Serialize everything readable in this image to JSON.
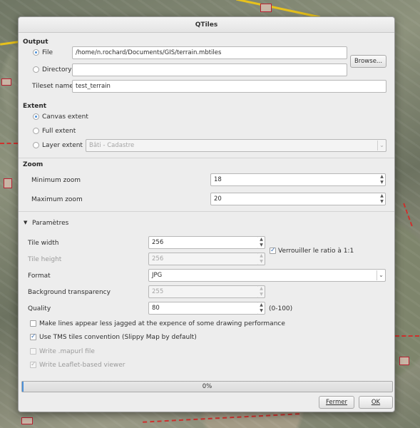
{
  "window": {
    "title": "QTiles"
  },
  "output": {
    "section": "Output",
    "file_label": "File",
    "file_value": "/home/n.rochard/Documents/GIS/terrain.mbtiles",
    "browse_label": "Browse...",
    "directory_label": "Directory",
    "directory_value": "",
    "tileset_label": "Tileset name",
    "tileset_value": "test_terrain"
  },
  "extent": {
    "section": "Extent",
    "canvas_label": "Canvas extent",
    "full_label": "Full extent",
    "layer_label": "Layer extent",
    "layer_value": "Bâti - Cadastre"
  },
  "zoom": {
    "section": "Zoom",
    "min_label": "Minimum zoom",
    "min_value": "18",
    "max_label": "Maximum zoom",
    "max_value": "20"
  },
  "params": {
    "section": "Paramètres",
    "tile_width_label": "Tile width",
    "tile_width_value": "256",
    "tile_height_label": "Tile height",
    "tile_height_value": "256",
    "lock_ratio_label": "Verrouiller le ratio à 1:1",
    "format_label": "Format",
    "format_value": "JPG",
    "bg_transparency_label": "Background transparency",
    "bg_transparency_value": "255",
    "quality_label": "Quality",
    "quality_value": "80",
    "quality_range": "(0-100)",
    "antialias_label": "Make lines appear less jagged at the expence of some drawing performance",
    "tms_label": "Use TMS tiles convention (Slippy Map by default)",
    "mapurl_label": "Write .mapurl file",
    "leaflet_label": "Write Leaflet-based viewer"
  },
  "progress": {
    "text": "0%",
    "value": 0
  },
  "buttons": {
    "close": "Fermer",
    "ok": "OK"
  },
  "icons": {
    "expander": "triangle-down-icon",
    "checkmark": "checkmark-icon",
    "spin": "spinner-arrows-icon",
    "dropdown": "chevron-down-icon"
  },
  "colors": {
    "accent": "#4a90d9",
    "dialog_bg": "#ededed"
  }
}
